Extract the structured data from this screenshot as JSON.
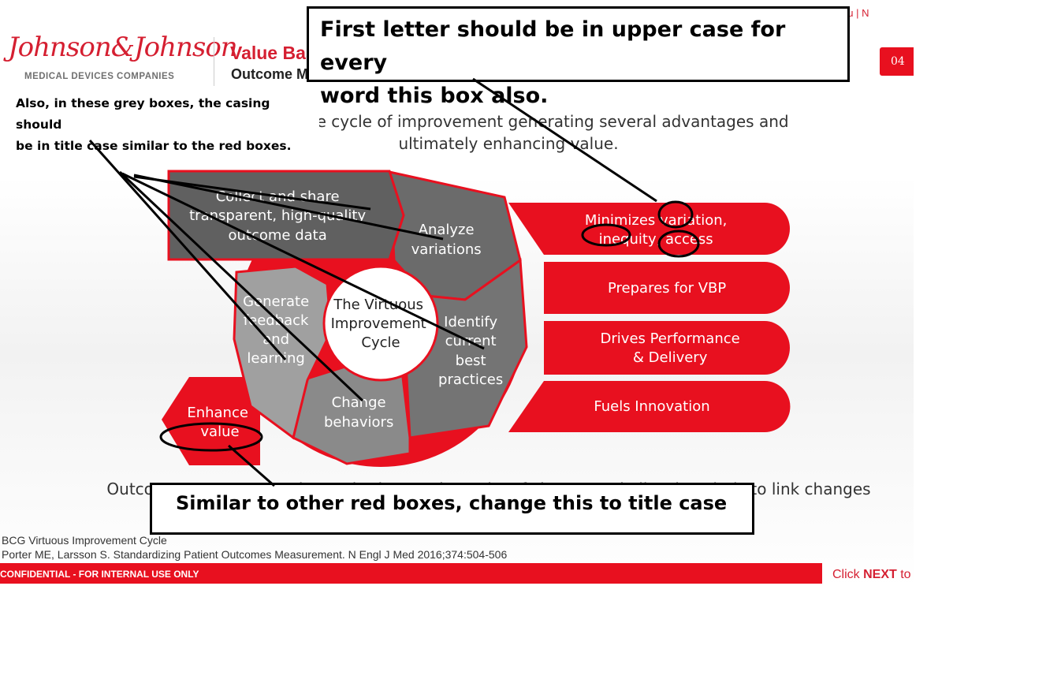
{
  "logo": {
    "line1": "Johnson&Johnson",
    "line2": "MEDICAL DEVICES COMPANIES"
  },
  "header": {
    "title": "Value Bas",
    "subtitle": "Outcome Measurement",
    "nav": "Menu  |  N",
    "page_badge": "04"
  },
  "intro": {
    "line1": "tegral to the cycle of improvement generating several advantages and",
    "line2": "ultimately enhancing value."
  },
  "cycle": {
    "center": [
      "The Virtuous",
      "Improvement",
      "Cycle"
    ],
    "collect": [
      "Collect and share",
      "transparent, high-quality",
      "outcome data"
    ],
    "analyze": [
      "Analyze",
      "variations"
    ],
    "identify": [
      "Identify",
      "current",
      "best",
      "practices"
    ],
    "change": [
      "Change",
      "behaviors"
    ],
    "feedback": [
      "Generate",
      "feedback",
      "and",
      "learning"
    ],
    "enhance": [
      "Enhance",
      "value"
    ]
  },
  "benefits": [
    [
      "Minimizes variation,",
      "inequity, access"
    ],
    [
      "Prepares for VBP"
    ],
    [
      "Drives Performance",
      "& Delivery"
    ],
    [
      "Fuels Innovation"
    ]
  ],
  "outro": "Outcome measurement is required to track results of change and allow hospitals to link changes",
  "references": [
    "BCG Virtuous Improvement Cycle",
    "Porter ME, Larsson S. Standardizing Patient Outcomes Measurement. N Engl J Med 2016;374:504-506"
  ],
  "footer": {
    "confidential": "CONFIDENTIAL - FOR INTERNAL USE ONLY",
    "click_prefix": "Click ",
    "click_next": "NEXT",
    "click_suffix": " to"
  },
  "annotations": {
    "callout_top": [
      "First letter should be in upper case for every",
      "word this box also."
    ],
    "callout_grey": [
      "Also, in these grey boxes, the casing should",
      "be in title case similar to the red boxes."
    ],
    "callout_bottom": "Similar to other red boxes, change this to title case"
  },
  "colors": {
    "red": "#e8101f",
    "dark_grey": "#666666",
    "mid_grey": "#7a7a7a",
    "light_grey": "#9a9a9a"
  }
}
